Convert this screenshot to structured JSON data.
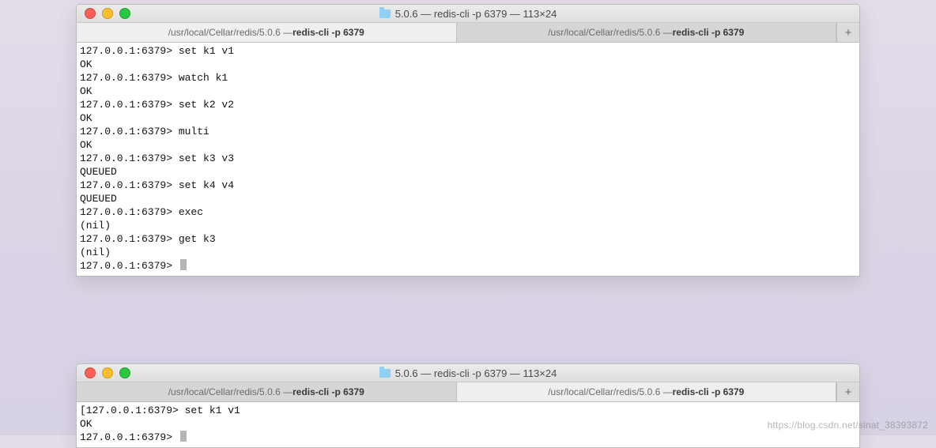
{
  "watermark": "https://blog.csdn.net/sinat_38393872",
  "window1": {
    "title": "5.0.6 — redis-cli -p 6379 — 113×24",
    "tabs": [
      {
        "path": "/usr/local/Cellar/redis/5.0.6 — ",
        "cmd": "redis-cli -p 6379",
        "active": true
      },
      {
        "path": "/usr/local/Cellar/redis/5.0.6 — ",
        "cmd": "redis-cli -p 6379",
        "active": false
      }
    ],
    "newtab": "+",
    "prompt": "127.0.0.1:6379>",
    "lines": [
      {
        "p": true,
        "t": "set k1 v1"
      },
      {
        "p": false,
        "t": "OK"
      },
      {
        "p": true,
        "t": "watch k1"
      },
      {
        "p": false,
        "t": "OK"
      },
      {
        "p": true,
        "t": "set k2 v2"
      },
      {
        "p": false,
        "t": "OK"
      },
      {
        "p": true,
        "t": "multi"
      },
      {
        "p": false,
        "t": "OK"
      },
      {
        "p": true,
        "t": "set k3 v3"
      },
      {
        "p": false,
        "t": "QUEUED"
      },
      {
        "p": true,
        "t": "set k4 v4"
      },
      {
        "p": false,
        "t": "QUEUED"
      },
      {
        "p": true,
        "t": "exec"
      },
      {
        "p": false,
        "t": "(nil)"
      },
      {
        "p": true,
        "t": "get k3"
      },
      {
        "p": false,
        "t": "(nil)"
      },
      {
        "p": true,
        "t": "",
        "cursor": true
      }
    ]
  },
  "window2": {
    "title": "5.0.6 — redis-cli -p 6379 — 113×24",
    "tabs": [
      {
        "path": "/usr/local/Cellar/redis/5.0.6 — ",
        "cmd": "redis-cli -p 6379",
        "active": false
      },
      {
        "path": "/usr/local/Cellar/redis/5.0.6 — ",
        "cmd": "redis-cli -p 6379",
        "active": true
      }
    ],
    "newtab": "+",
    "prompt": "127.0.0.1:6379>",
    "lines": [
      {
        "p": true,
        "t": "set k1 v1",
        "pre": "["
      },
      {
        "p": false,
        "t": "OK"
      },
      {
        "p": true,
        "t": "",
        "cursor": true
      }
    ]
  }
}
